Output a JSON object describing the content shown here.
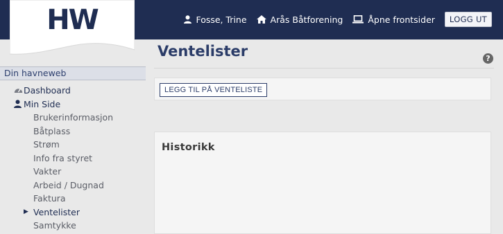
{
  "logo": {
    "text": "HW"
  },
  "topnav": {
    "user_name": "Fosse, Trine",
    "club_name": "Arås Båtforening",
    "frontpage_label": "Åpne frontsider",
    "logout_label": "LOGG UT"
  },
  "sidebar": {
    "section_title": "Din havneweb",
    "items": [
      {
        "label": "Dashboard",
        "icon": "dashboard-icon"
      },
      {
        "label": "Min Side",
        "icon": "user-icon"
      },
      {
        "label": "Brukerinformasjon"
      },
      {
        "label": "Båtplass"
      },
      {
        "label": "Strøm"
      },
      {
        "label": "Info fra styret"
      },
      {
        "label": "Vakter"
      },
      {
        "label": "Arbeid / Dugnad"
      },
      {
        "label": "Faktura"
      },
      {
        "label": "Ventelister",
        "active": true
      },
      {
        "label": "Samtykke"
      }
    ]
  },
  "main": {
    "title": "Ventelister",
    "add_button_label": "LEGG TIL PÅ VENTELISTE",
    "history_title": "Historikk"
  },
  "colors": {
    "navy": "#1f2d52",
    "title": "#2b3c68",
    "background": "#e9e9e9"
  }
}
